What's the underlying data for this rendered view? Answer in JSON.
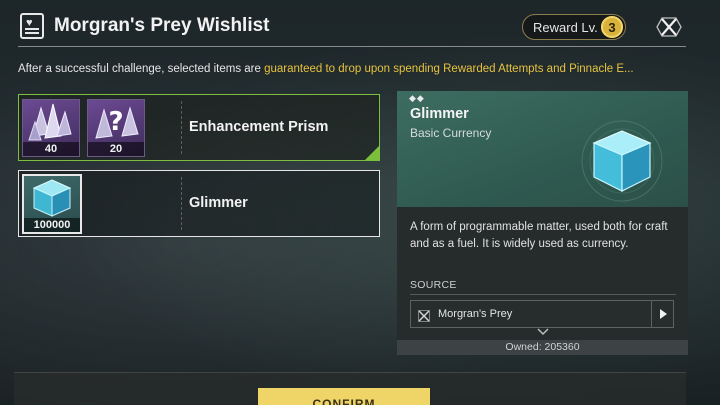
{
  "header": {
    "title": "Morgran's Prey Wishlist",
    "reward_label": "Reward Lv.",
    "reward_level": "3"
  },
  "description": {
    "prefix": "After a successful challenge, selected items are ",
    "highlight": "guaranteed to drop upon spending Rewarded Attempts and Pinnacle E..."
  },
  "wishlist": [
    {
      "name": "Enhancement Prism",
      "selected": true,
      "slots": [
        {
          "quantity": "40",
          "icon": "enhancement-prism-icon"
        },
        {
          "quantity": "20",
          "icon": "enhancement-prism-mystery-icon"
        }
      ]
    },
    {
      "name": "Glimmer",
      "selected": false,
      "slots": [
        {
          "quantity": "100000",
          "icon": "glimmer-cube-icon"
        }
      ]
    }
  ],
  "detail": {
    "dots": "◆◆",
    "name": "Glimmer",
    "type": "Basic Currency",
    "description": "A form of programmable matter, used both for craft and as a fuel. It is widely used as currency.",
    "source_label": "SOURCE",
    "source_item": "Morgran's Prey",
    "owned": "Owned: 205360"
  },
  "actions": {
    "confirm": "CONFIRM"
  },
  "colors": {
    "accent_yellow": "#e6c23f",
    "selected_green": "#7bbf3c",
    "confirm_bg": "#efd468"
  }
}
